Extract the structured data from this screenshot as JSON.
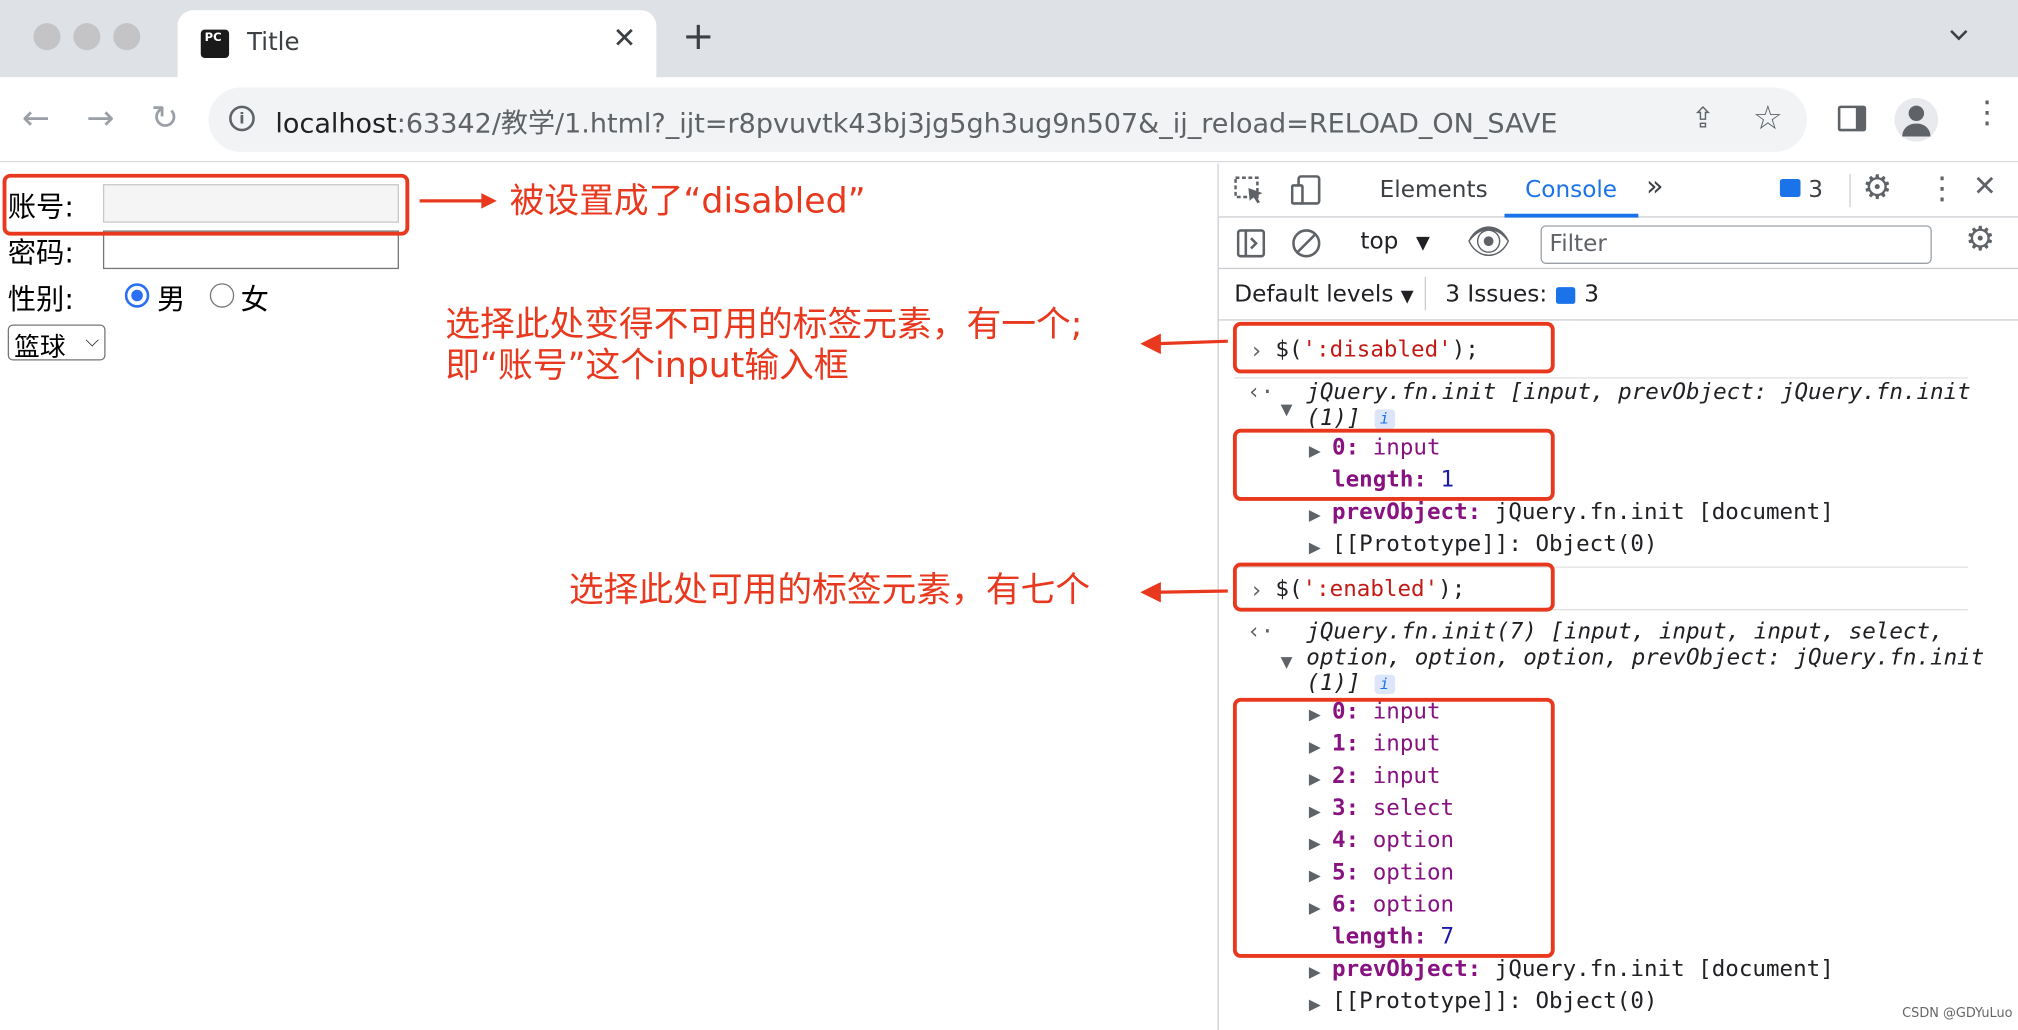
{
  "browser": {
    "tab_title": "Title",
    "favicon_text": "PC",
    "url_host": "localhost",
    "url_rest": ":63342/教学/1.html?_ijt=r8pvuvtk43bj3jg5gh3ug9n507&_ij_reload=RELOAD_ON_SAVE"
  },
  "form": {
    "account_label": "账号:",
    "password_label": "密码:",
    "gender_label": "性别:",
    "male": "男",
    "female": "女",
    "select_value": "篮球"
  },
  "annotations": {
    "disabled_note": "被设置成了“disabled”",
    "disabled_desc_1": "选择此处变得不可用的标签元素，有一个;",
    "disabled_desc_2": "即“账号”这个input输入框",
    "enabled_desc": "选择此处可用的标签元素，有七个"
  },
  "devtools": {
    "tabs": [
      "Elements",
      "Console"
    ],
    "more_tabs": "»",
    "message_count": "3",
    "context": "top",
    "filter_placeholder": "Filter",
    "default_levels": "Default levels",
    "issues_label": "3 Issues:",
    "issues_count": "3"
  },
  "console": {
    "cmd1": "$(':disabled');",
    "res1_line1": "jQuery.fn.init [input, prevObject: jQuery.fn.init",
    "res1_line2": "(1)]",
    "res1_items": [
      {
        "key": "0:",
        "value": "input"
      }
    ],
    "res1_length": "1",
    "prev_key": "prevObject:",
    "prev_value": "jQuery.fn.init [document]",
    "proto": "[[Prototype]]: Object(0)",
    "cmd2": "$(':enabled');",
    "res2_line1": "jQuery.fn.init(7) [input, input, input, select,",
    "res2_line2": "option, option, option, prevObject: jQuery.fn.init",
    "res2_line3": "(1)]",
    "res2_items": [
      {
        "key": "0:",
        "value": "input"
      },
      {
        "key": "1:",
        "value": "input"
      },
      {
        "key": "2:",
        "value": "input"
      },
      {
        "key": "3:",
        "value": "select"
      },
      {
        "key": "4:",
        "value": "option"
      },
      {
        "key": "5:",
        "value": "option"
      },
      {
        "key": "6:",
        "value": "option"
      }
    ],
    "res2_length": "7",
    "length_key": "length:"
  },
  "watermark": "CSDN @GDYuLuo",
  "colors": {
    "annotation_red": "#e8391f",
    "accent_blue": "#1a73e8",
    "prop_purple": "#881280"
  }
}
